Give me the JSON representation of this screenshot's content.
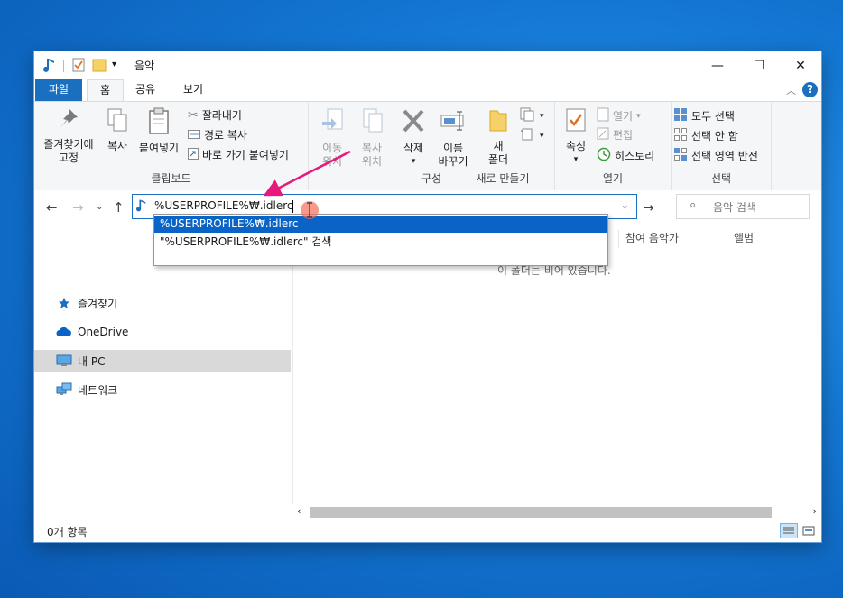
{
  "window": {
    "title": "음악",
    "controls": {
      "minimize": "—",
      "maximize": "☐",
      "close": "✕"
    }
  },
  "ribbon_tabs": [
    "파일",
    "홈",
    "공유",
    "보기"
  ],
  "ribbon": {
    "clipboard": {
      "label": "클립보드",
      "pin_line1": "즐겨찾기에",
      "pin_line2": "고정",
      "copy": "복사",
      "paste": "붙여넣기",
      "cut": "잘라내기",
      "copy_path": "경로 복사",
      "paste_shortcut": "바로 가기 붙여넣기"
    },
    "organize": {
      "label": "구성",
      "move_line1": "이동",
      "move_line2": "위치",
      "copyto_line1": "복사",
      "copyto_line2": "위치",
      "delete": "삭제",
      "rename_line1": "이름",
      "rename_line2": "바꾸기"
    },
    "new": {
      "label": "새로 만들기",
      "newfolder_line1": "새",
      "newfolder_line2": "폴더"
    },
    "open": {
      "label": "열기",
      "properties": "속성",
      "open": "열기",
      "edit": "편집",
      "history": "히스토리"
    },
    "select": {
      "label": "선택",
      "select_all": "모두 선택",
      "select_none": "선택 안 함",
      "invert": "선택 영역 반전"
    }
  },
  "address": {
    "value": "%USERPROFILE%₩.idlerc",
    "search_placeholder": "음악 검색"
  },
  "autocomplete": [
    "%USERPROFILE%₩.idlerc",
    "\"%USERPROFILE%₩.idlerc\" 검색"
  ],
  "nav_pane": [
    {
      "label": "즐겨찾기",
      "icon": "star-icon"
    },
    {
      "label": "OneDrive",
      "icon": "cloud-icon"
    },
    {
      "label": "내 PC",
      "icon": "computer-icon",
      "selected": true
    },
    {
      "label": "네트워크",
      "icon": "network-icon"
    }
  ],
  "columns": [
    "참여 음악가",
    "앨범"
  ],
  "empty_message": "이 폴더는 비어 있습니다.",
  "status": {
    "items": "0개 항목"
  },
  "colors": {
    "accent": "#1a6fbf",
    "selection": "#0a64c8",
    "annotation": "#e8197d"
  }
}
